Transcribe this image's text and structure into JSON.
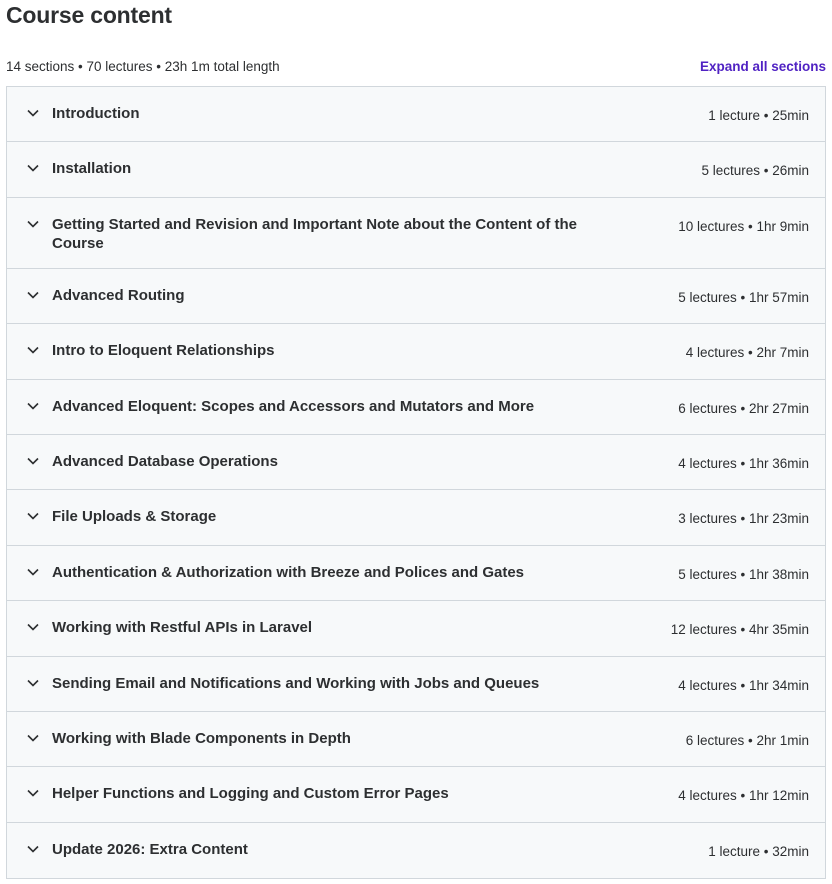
{
  "header": {
    "title": "Course content",
    "summary": "14 sections • 70 lectures • 23h 1m total length",
    "expand_all_label": "Expand all sections"
  },
  "accent_color": "#5022c3",
  "sections": [
    {
      "title": "Introduction",
      "meta": "1 lecture • 25min"
    },
    {
      "title": "Installation",
      "meta": "5 lectures • 26min"
    },
    {
      "title": "Getting Started and Revision and Important Note about the Content of the Course",
      "meta": "10 lectures • 1hr 9min"
    },
    {
      "title": "Advanced Routing",
      "meta": "5 lectures • 1hr 57min"
    },
    {
      "title": "Intro to Eloquent Relationships",
      "meta": "4 lectures • 2hr 7min"
    },
    {
      "title": "Advanced Eloquent: Scopes and Accessors and Mutators and More",
      "meta": "6 lectures • 2hr 27min"
    },
    {
      "title": "Advanced Database Operations",
      "meta": "4 lectures • 1hr 36min"
    },
    {
      "title": "File Uploads & Storage",
      "meta": "3 lectures • 1hr 23min"
    },
    {
      "title": "Authentication & Authorization with Breeze and Polices and Gates",
      "meta": "5 lectures • 1hr 38min"
    },
    {
      "title": "Working with Restful APIs in Laravel",
      "meta": "12 lectures • 4hr 35min"
    },
    {
      "title": "Sending Email and Notifications and Working with Jobs and Queues",
      "meta": "4 lectures • 1hr 34min"
    },
    {
      "title": "Working with Blade Components in Depth",
      "meta": "6 lectures • 2hr 1min"
    },
    {
      "title": "Helper Functions and Logging and Custom Error Pages",
      "meta": "4 lectures • 1hr 12min"
    },
    {
      "title": "Update 2026: Extra Content",
      "meta": "1 lecture • 32min"
    }
  ]
}
